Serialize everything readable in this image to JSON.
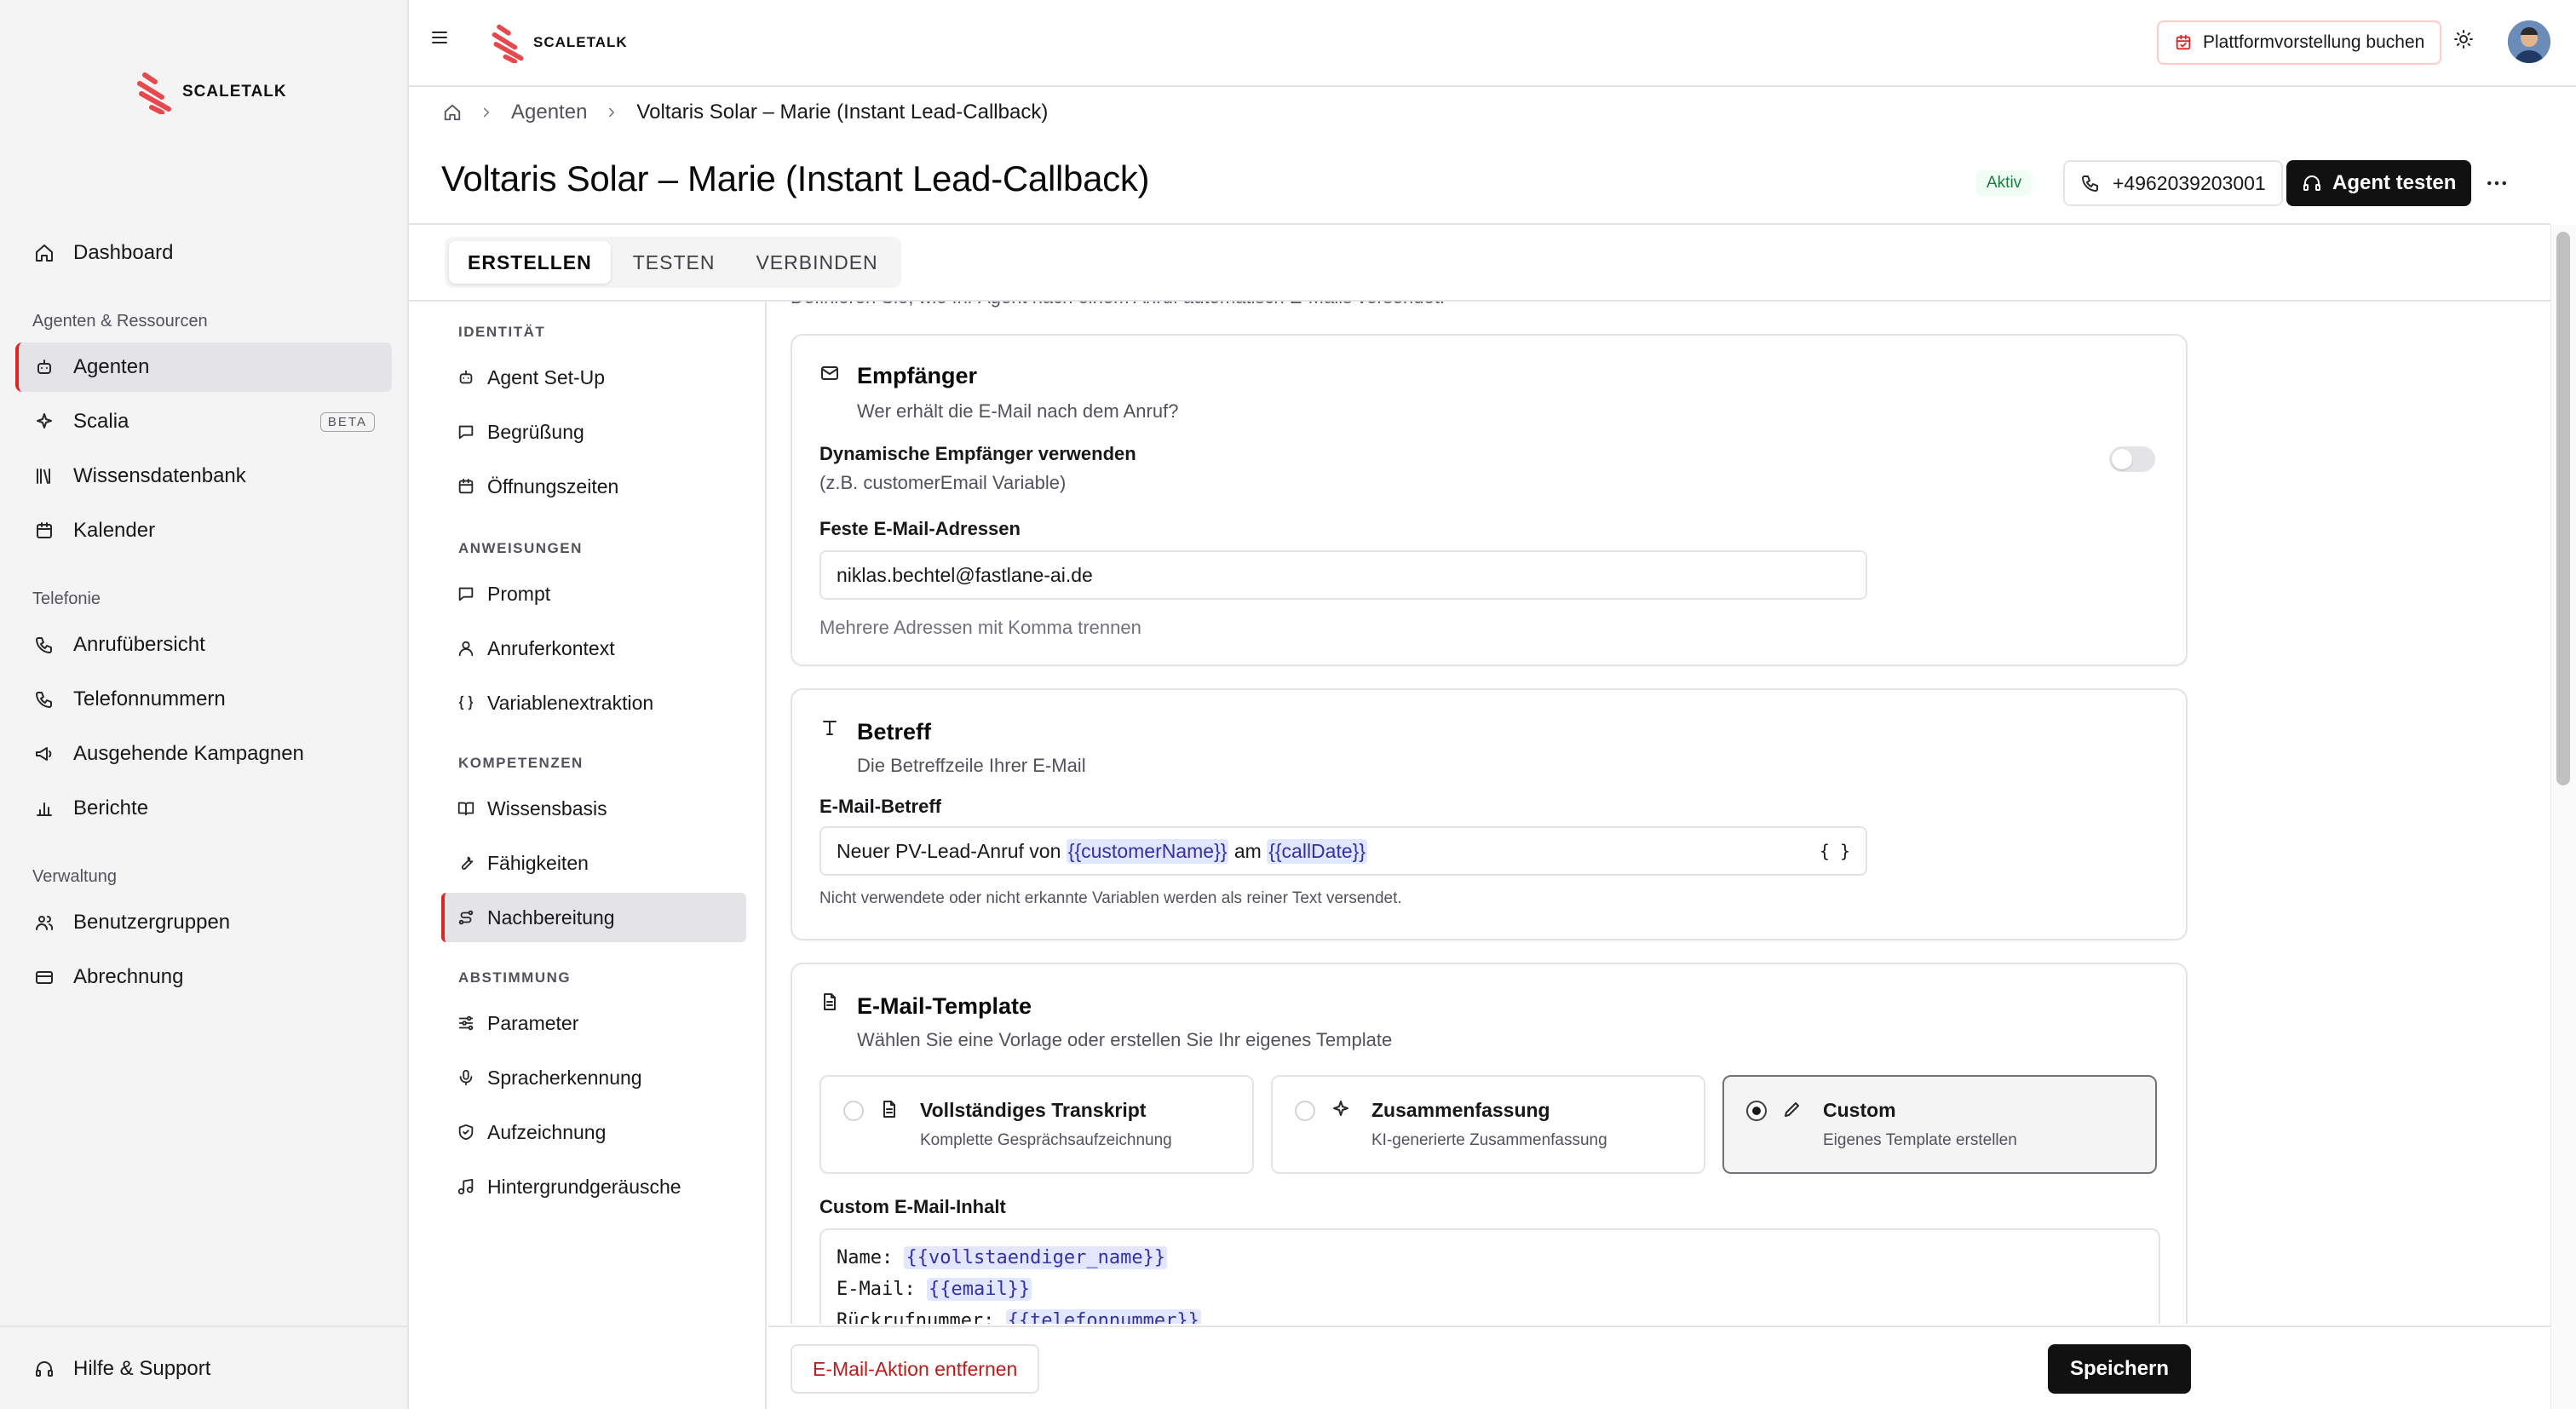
{
  "brand": {
    "name": "SCALETALK",
    "accent": "#dc2626"
  },
  "sidebar": {
    "items_top": [
      {
        "label": "Dashboard",
        "icon": "home-icon"
      }
    ],
    "section_agents": "Agenten & Ressourcen",
    "items_agents": [
      {
        "label": "Agenten",
        "icon": "bot-icon",
        "active": true
      },
      {
        "label": "Scalia",
        "icon": "sparkles-icon",
        "badge": "BETA"
      },
      {
        "label": "Wissensdatenbank",
        "icon": "library-icon"
      },
      {
        "label": "Kalender",
        "icon": "calendar-icon"
      }
    ],
    "section_telephony": "Telefonie",
    "items_telephony": [
      {
        "label": "Anrufübersicht",
        "icon": "phone-icon"
      },
      {
        "label": "Telefonnummern",
        "icon": "phone-icon"
      },
      {
        "label": "Ausgehende Kampagnen",
        "icon": "megaphone-icon"
      },
      {
        "label": "Berichte",
        "icon": "bar-chart-icon"
      }
    ],
    "section_admin": "Verwaltung",
    "items_admin": [
      {
        "label": "Benutzergruppen",
        "icon": "users-icon"
      },
      {
        "label": "Abrechnung",
        "icon": "credit-card-icon"
      }
    ],
    "footer_item": {
      "label": "Hilfe & Support",
      "icon": "headset-icon"
    }
  },
  "topbar": {
    "demo_label": "Plattformvorstellung buchen"
  },
  "breadcrumb": {
    "parent": "Agenten",
    "current": "Voltaris Solar – Marie (Instant Lead-Callback)"
  },
  "header": {
    "title": "Voltaris Solar – Marie (Instant Lead-Callback)",
    "status": "Aktiv",
    "phone": "+4962039203001",
    "test_label": "Agent testen"
  },
  "tabs": [
    {
      "label": "ERSTELLEN",
      "active": true
    },
    {
      "label": "TESTEN"
    },
    {
      "label": "VERBINDEN"
    }
  ],
  "settings_nav": {
    "identity": {
      "title": "IDENTITÄT",
      "items": [
        "Agent Set-Up",
        "Begrüßung",
        "Öffnungszeiten"
      ]
    },
    "instructions": {
      "title": "ANWEISUNGEN",
      "items": [
        "Prompt",
        "Anruferkontext",
        "Variablenextraktion"
      ]
    },
    "skills": {
      "title": "KOMPETENZEN",
      "items": [
        "Wissensbasis",
        "Fähigkeiten",
        "Nachbereitung"
      ]
    },
    "tuning": {
      "title": "ABSTIMMUNG",
      "items": [
        "Parameter",
        "Spracherkennung",
        "Aufzeichnung",
        "Hintergrundgeräusche"
      ]
    },
    "active_item": "Nachbereitung"
  },
  "content": {
    "intro": "Definieren Sie, wie Ihr Agent nach einem Anruf automatisch E-Mails versendet.",
    "recipients": {
      "title": "Empfänger",
      "subtitle": "Wer erhält die E-Mail nach dem Anruf?",
      "dynamic_label": "Dynamische Empfänger verwenden",
      "dynamic_hint": "(z.B. customerEmail Variable)",
      "dynamic_enabled": false,
      "fixed_label": "Feste E-Mail-Adressen",
      "fixed_value": "niklas.bechtel@fastlane-ai.de",
      "fixed_hint": "Mehrere Adressen mit Komma trennen"
    },
    "subject": {
      "title": "Betreff",
      "subtitle": "Die Betreffzeile Ihrer E-Mail",
      "label": "E-Mail-Betreff",
      "value_prefix": "Neuer PV-Lead-Anruf von ",
      "var1": "{{customerName}}",
      "value_mid": " am ",
      "var2": "{{callDate}}",
      "var_button": "{ }",
      "hint": "Nicht verwendete oder nicht erkannte Variablen werden als reiner Text versendet."
    },
    "template": {
      "title": "E-Mail-Template",
      "subtitle": "Wählen Sie eine Vorlage oder erstellen Sie Ihr eigenes Template",
      "options": [
        {
          "title": "Vollständiges Transkript",
          "subtitle": "Komplette Gesprächsaufzeichnung",
          "icon": "file-text-icon"
        },
        {
          "title": "Zusammenfassung",
          "subtitle": "KI-generierte Zusammenfassung",
          "icon": "sparkles-icon"
        },
        {
          "title": "Custom",
          "subtitle": "Eigenes Template erstellen",
          "icon": "pencil-icon",
          "selected": true
        }
      ],
      "custom_label": "Custom E-Mail-Inhalt",
      "custom_lines": [
        {
          "key": "Name: ",
          "var": "{{vollstaendiger_name}}"
        },
        {
          "key": "E-Mail: ",
          "var": "{{email}}"
        },
        {
          "key": "Rückrufnummer: ",
          "var": "{{telefonnummer}}"
        }
      ]
    }
  },
  "footer": {
    "remove_label": "E-Mail-Aktion entfernen",
    "save_label": "Speichern"
  }
}
